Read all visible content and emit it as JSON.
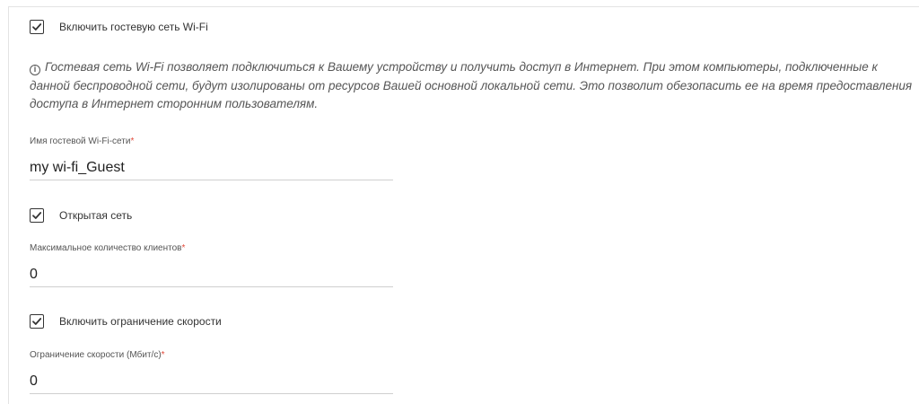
{
  "guest_wifi": {
    "enable_label": "Включить гостевую сеть Wi-Fi",
    "enable_checked": true,
    "info_text": "Гостевая сеть Wi-Fi позволяет подключиться к Вашему устройству и получить доступ в Интернет. При этом компьютеры, подключенные к данной беспроводной сети, будут изолированы от ресурсов Вашей основной локальной сети. Это позволит обезопасить ее на время предоставления доступа в Интернет сторонним пользователям.",
    "info_icon": "i"
  },
  "ssid": {
    "label": "Имя гостевой Wi-Fi-сети",
    "required_mark": "*",
    "value": "my wi-fi_Guest"
  },
  "open_network": {
    "label": "Открытая сеть",
    "checked": true
  },
  "max_clients": {
    "label": "Максимальное количество клиентов",
    "required_mark": "*",
    "value": "0"
  },
  "speed_limit_toggle": {
    "label": "Включить ограничение скорости",
    "checked": true
  },
  "speed_limit": {
    "label": "Ограничение скорости (Мбит/с)",
    "required_mark": "*",
    "value": "0"
  },
  "colors": {
    "required": "#e24a3b",
    "text": "#333333",
    "underline": "#cfcfcf"
  },
  "icons": {
    "checkbox": "checkmark-icon",
    "info": "info-circle-icon"
  }
}
